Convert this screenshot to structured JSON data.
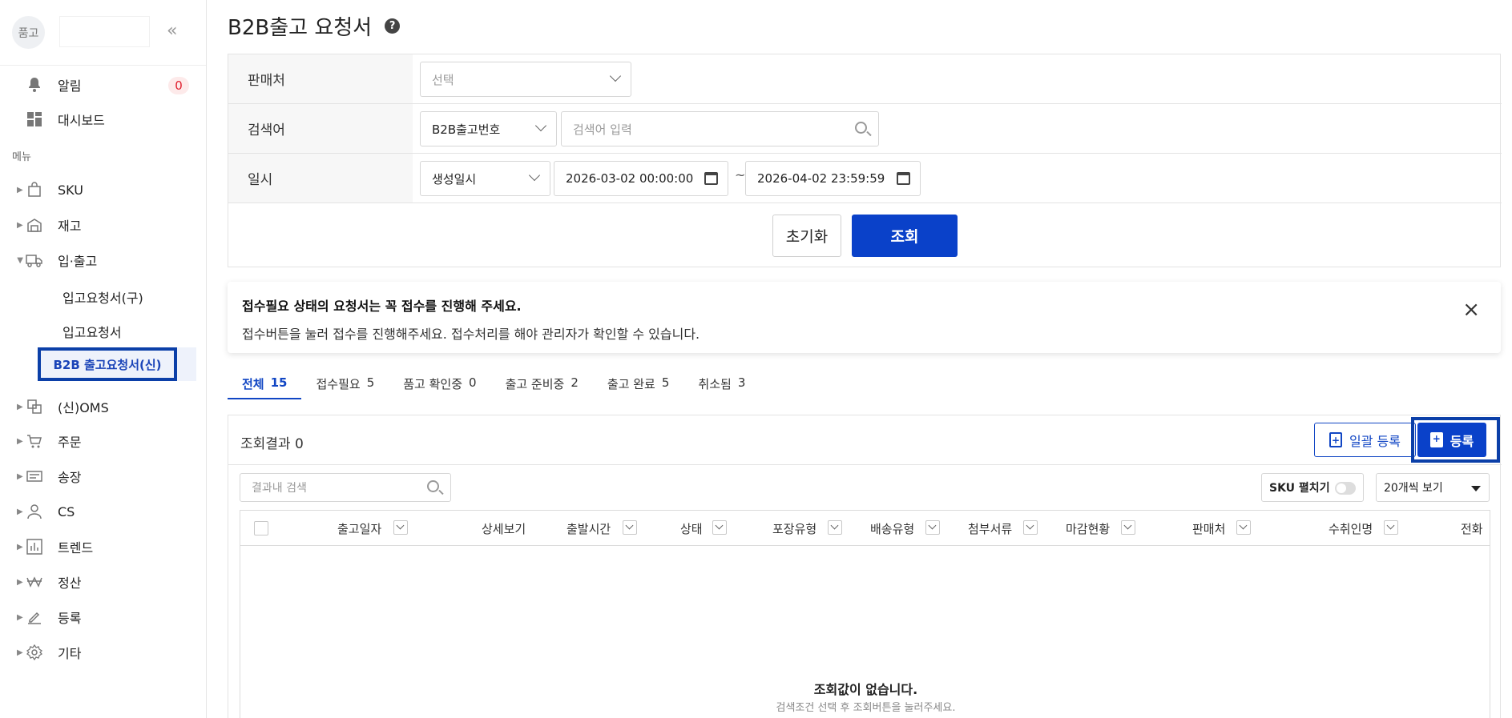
{
  "sidebar": {
    "avatar_text": "품고",
    "collapse_icon": "double-chevron-left-icon",
    "alerts": {
      "label": "알림",
      "count": "0"
    },
    "dashboard": {
      "label": "대시보드"
    },
    "section_label": "메뉴",
    "items": [
      {
        "label": "SKU",
        "icon": "shopping-bag-icon"
      },
      {
        "label": "재고",
        "icon": "warehouse-icon"
      },
      {
        "label": "입·출고",
        "icon": "truck-icon"
      },
      {
        "label": "(신)OMS",
        "icon": "oms-icon"
      },
      {
        "label": "주문",
        "icon": "cart-icon"
      },
      {
        "label": "송장",
        "icon": "invoice-icon"
      },
      {
        "label": "CS",
        "icon": "user-icon"
      },
      {
        "label": "트렌드",
        "icon": "chart-icon"
      },
      {
        "label": "정산",
        "icon": "won-icon"
      },
      {
        "label": "등록",
        "icon": "pencil-icon"
      },
      {
        "label": "기타",
        "icon": "gear-icon"
      }
    ],
    "sub_items": [
      "입고요청서(구)",
      "입고요청서",
      "B2B 출고요청서(신)"
    ]
  },
  "page": {
    "title": "B2B출고 요청서",
    "help_icon": "?"
  },
  "filter": {
    "seller_label": "판매처",
    "seller_placeholder": "선택",
    "keyword_label": "검색어",
    "keyword_type": "B2B출고번호",
    "keyword_placeholder": "검색어 입력",
    "date_label": "일시",
    "date_type": "생성일시",
    "date_from": "2026-03-02 00:00:00",
    "date_sep": "~",
    "date_to": "2026-04-02 23:59:59",
    "reset_label": "초기화",
    "search_label": "조회"
  },
  "notice": {
    "title": "접수필요 상태의 요청서는 꼭 접수를 진행해 주세요.",
    "body": "접수버튼을 눌러 접수를 진행해주세요. 접수처리를 해야 관리자가 확인할 수 있습니다.",
    "close": "×"
  },
  "tabs": [
    {
      "label": "전체",
      "count": "15",
      "active": true
    },
    {
      "label": "접수필요",
      "count": "5"
    },
    {
      "label": "품고 확인중",
      "count": "0"
    },
    {
      "label": "출고 준비중",
      "count": "2"
    },
    {
      "label": "출고 완료",
      "count": "5"
    },
    {
      "label": "취소됨",
      "count": "3"
    }
  ],
  "result": {
    "count_label": "조회결과 0",
    "bulk_label": "일괄 등록",
    "register_label": "등록",
    "inner_search_placeholder": "결과내 검색",
    "sku_toggle_label": "SKU 펼치기",
    "per_page": "20개씩 보기",
    "columns": [
      "출고일자",
      "상세보기",
      "출발시간",
      "상태",
      "포장유형",
      "배송유형",
      "첨부서류",
      "마감현황",
      "판매처",
      "수취인명",
      "전화"
    ],
    "empty_title": "조회값이 없습니다.",
    "empty_desc": "검색조건 선택 후 조회버튼을 눌러주세요."
  }
}
